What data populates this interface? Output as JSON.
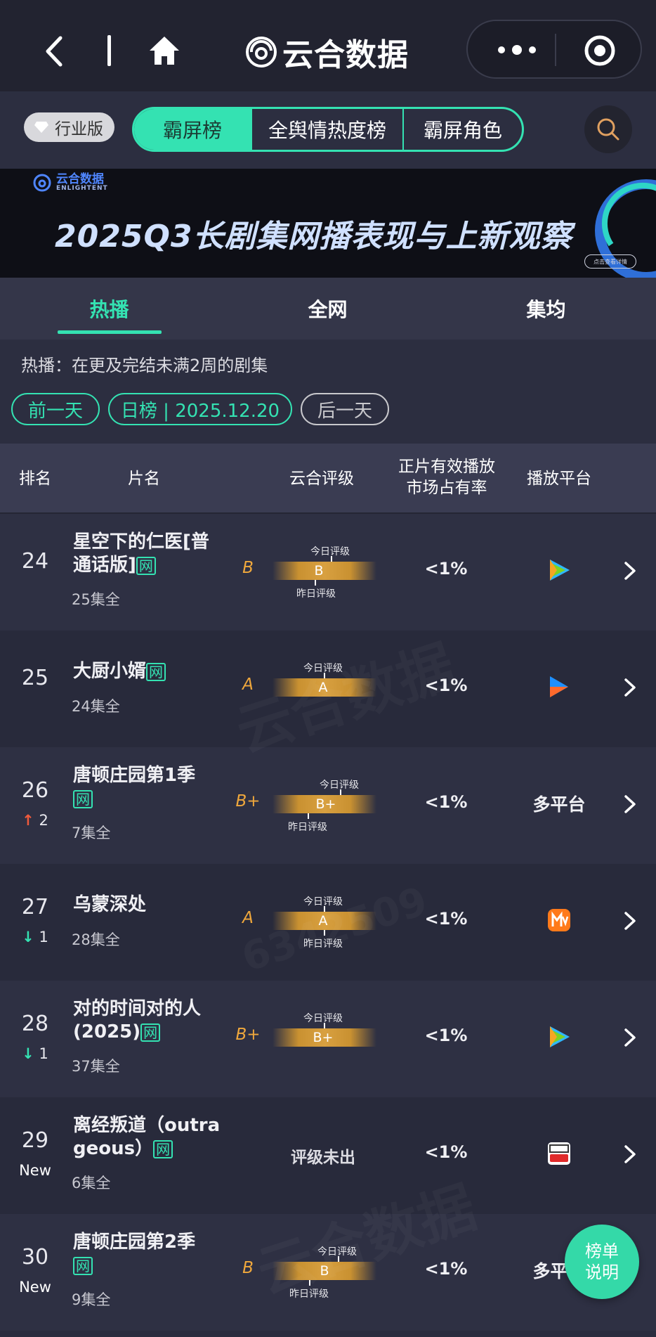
{
  "app": {
    "title": "云合数据"
  },
  "toolbar": {
    "edition": "行业版"
  },
  "rank_tabs": [
    {
      "label": "霸屏榜",
      "active": true
    },
    {
      "label": "全舆情热度榜",
      "active": false
    },
    {
      "label": "霸屏角色",
      "active": false
    }
  ],
  "banner": {
    "brand_cn": "云合数据",
    "brand_en": "ENLIGHTENT",
    "title": "2025Q3长剧集网播表现与上新观察",
    "button": "点击查看详情"
  },
  "category_tabs": [
    {
      "label": "热播",
      "active": true
    },
    {
      "label": "全网",
      "active": false
    },
    {
      "label": "集均",
      "active": false
    }
  ],
  "description": "热播：在更及完结未满2周的剧集",
  "date_nav": {
    "prev": "前一天",
    "current": "日榜 | 2025.12.20",
    "next": "后一天"
  },
  "table_header": {
    "rank": "排名",
    "title": "片名",
    "grade": "云合评级",
    "share_line1": "正片有效播放",
    "share_line2": "市场占有率",
    "platform": "播放平台"
  },
  "labels": {
    "today": "今日评级",
    "yesterday": "昨日评级",
    "net": "网"
  },
  "rows": [
    {
      "rank": "24",
      "change": "",
      "title_a": "星空下的仁医[普",
      "title_b": "通话版]",
      "episodes": "25集全",
      "grade": "B",
      "share": "<1%",
      "platform_text": "",
      "platform_icon": "tencent-video-icon"
    },
    {
      "rank": "25",
      "change": "",
      "title_a": "大厨小婿",
      "title_b": "",
      "episodes": "24集全",
      "grade": "A",
      "share": "<1%",
      "platform_text": "",
      "platform_icon": "youku-icon"
    },
    {
      "rank": "26",
      "change": "2",
      "title_a": "唐顿庄园第1季",
      "title_b": "",
      "episodes": "7集全",
      "grade": "B+",
      "share": "<1%",
      "platform_text": "多平台",
      "platform_icon": ""
    },
    {
      "rank": "27",
      "change": "1",
      "title_a": "乌蒙深处",
      "title_b": "",
      "episodes": "28集全",
      "grade": "A",
      "share": "<1%",
      "platform_text": "",
      "platform_icon": "mango-tv-icon"
    },
    {
      "rank": "28",
      "change": "1",
      "title_a": "对的时间对的人",
      "title_b": "(2025)",
      "episodes": "37集全",
      "grade": "B+",
      "share": "<1%",
      "platform_text": "",
      "platform_icon": "tencent-video-icon"
    },
    {
      "rank": "29",
      "change": "New",
      "title_a": "离经叛道（outra",
      "title_b": "geous）",
      "episodes": "6集全",
      "grade": "评级未出",
      "share": "<1%",
      "platform_text": "",
      "platform_icon": "sohu-video-icon"
    },
    {
      "rank": "30",
      "change": "New",
      "title_a": "唐顿庄园第2季",
      "title_b": "",
      "episodes": "9集全",
      "grade": "B",
      "share": "<1%",
      "platform_text": "多平台",
      "platform_icon": ""
    }
  ],
  "fab": {
    "line1": "榜单",
    "line2": "说明"
  },
  "watermark": {
    "brand": "云合数据",
    "brand_en": "ENLIGHTENT",
    "id": "6342509"
  },
  "colors": {
    "accent": "#34e2b2",
    "grade": "#f0a83c",
    "up": "#f05a3c",
    "down": "#34e2b2"
  }
}
